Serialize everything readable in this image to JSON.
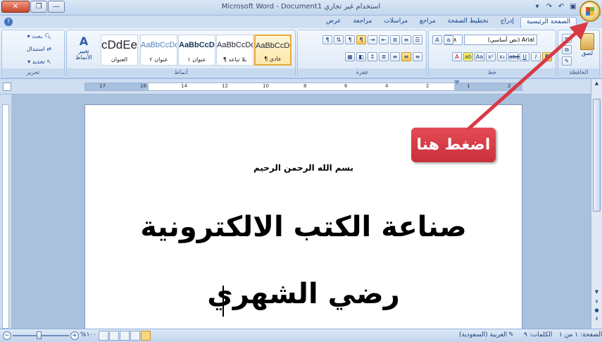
{
  "window": {
    "title": "Microsoft Word - Document1 استخدام غير تجاري",
    "close_label": "✕",
    "max_label": "❐",
    "min_label": "—"
  },
  "tabs": [
    {
      "label": "الصفحة الرئيسية",
      "active": true
    },
    {
      "label": "إدراج"
    },
    {
      "label": "تخطيط الصفحة"
    },
    {
      "label": "مراجع"
    },
    {
      "label": "مراسلات"
    },
    {
      "label": "مراجعة"
    },
    {
      "label": "عرض"
    }
  ],
  "ribbon": {
    "clipboard": {
      "label": "الحافظة",
      "paste_label": "لصق"
    },
    "font": {
      "label": "خط",
      "font_name": "Arial (نص أساسي)",
      "font_size": "٤٨",
      "bold_label": "B"
    },
    "paragraph": {
      "label": "فقرة"
    },
    "styles": {
      "label": "أنماط",
      "items": [
        {
          "sample": "AaBbCcDdEe",
          "name": "¶ عادي",
          "selected": true
        },
        {
          "sample": "AaBbCcDdEe",
          "name": "¶ بلا تباعد"
        },
        {
          "sample": "AaBbCcDdEe",
          "name": "عنوان ١"
        },
        {
          "sample": "AaBbCcDdEe",
          "name": "عنوان ٢"
        },
        {
          "sample": "AaBbCcDdEe",
          "name": "العنوان"
        }
      ],
      "change_label": "تغيير الأنماط"
    },
    "editing": {
      "label": "تحرير",
      "find_label": "بحث",
      "replace_label": "استبدال",
      "select_label": "تحديد"
    }
  },
  "ruler": {
    "numbers": [
      "2",
      "1",
      "2",
      "4",
      "6",
      "8",
      "10",
      "12",
      "14",
      "16",
      "17"
    ]
  },
  "document": {
    "basmala": "بسم الله الرحمن الرحيم",
    "title": "صناعة الكتب الالكترونية",
    "author": "رضي الشهري"
  },
  "callout": {
    "text": "اضغط هنا",
    "color": "#d83a45"
  },
  "statusbar": {
    "page": "الصفحة: ١ من ١",
    "words": "الكلمات: ٩",
    "language": "العربية (السعودية)",
    "zoom": "١٠٠%"
  }
}
